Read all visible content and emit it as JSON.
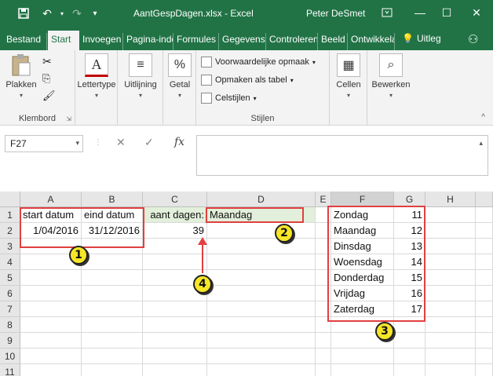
{
  "titlebar": {
    "title": "AantGespDagen.xlsx - Excel",
    "user": "Peter DeSmet",
    "icons": [
      "save-icon",
      "undo-icon",
      "redo-icon",
      "customize-qat-icon",
      "ribbon-display-icon",
      "minimize-icon",
      "maximize-icon",
      "close-icon"
    ]
  },
  "tabs": [
    "Bestand",
    "Start",
    "Invoegen",
    "Pagina-indeling",
    "Formules",
    "Gegevens",
    "Controleren",
    "Beeld",
    "Ontwikkelaars"
  ],
  "active_tab": "Start",
  "help": {
    "label": "Uitleg"
  },
  "ribbon": {
    "clipboard": {
      "paste_label": "Plakken",
      "group_label": "Klembord"
    },
    "font": {
      "label": "Lettertype"
    },
    "alignment": {
      "label": "Uitlijning"
    },
    "number": {
      "label": "Getal"
    },
    "styles": {
      "conditional": "Voorwaardelijke opmaak",
      "format_table": "Opmaken als tabel",
      "cell_styles": "Celstijlen",
      "group_label": "Stijlen"
    },
    "cells": {
      "label": "Cellen"
    },
    "editing": {
      "label": "Bewerken"
    }
  },
  "formula_bar": {
    "name_box": "F27",
    "fx": "fx",
    "formula": ""
  },
  "grid": {
    "columns": [
      "A",
      "B",
      "C",
      "D",
      "E",
      "F",
      "G",
      "H"
    ],
    "rows": [
      "1",
      "2",
      "3",
      "4",
      "5",
      "6",
      "7",
      "8",
      "9",
      "10",
      "11"
    ],
    "cells": {
      "A1": "start datum",
      "B1": "eind datum",
      "C1": "aant dagen:",
      "D1": "Maandag",
      "A2": "1/04/2016",
      "B2": "31/12/2016",
      "C2": "39",
      "F1": "Zondag",
      "G1": "11",
      "F2": "Maandag",
      "G2": "12",
      "F3": "Dinsdag",
      "G3": "13",
      "F4": "Woensdag",
      "G4": "14",
      "F5": "Donderdag",
      "G5": "15",
      "F6": "Vrijdag",
      "G6": "16",
      "F7": "Zaterdag",
      "G7": "17"
    }
  },
  "annotations": {
    "b1": "1",
    "b2": "2",
    "b3": "3",
    "b4": "4"
  },
  "colors": {
    "excel_green": "#217346",
    "highlight_red": "#e04040",
    "badge_yellow": "#f7e627",
    "cell_green": "#e2efda"
  }
}
